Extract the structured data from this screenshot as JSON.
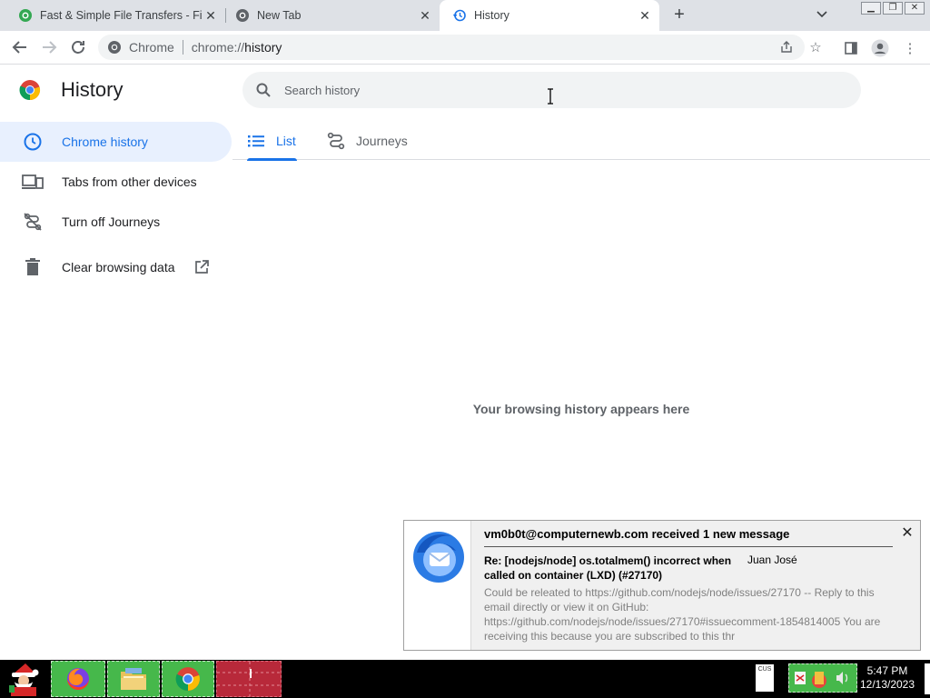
{
  "tabs": [
    {
      "title": "Fast & Simple File Transfers - File",
      "icon": "green-globe-icon"
    },
    {
      "title": "New Tab",
      "icon": "chrome-globe-icon"
    },
    {
      "title": "History",
      "icon": "history-clock-icon"
    }
  ],
  "omnibox": {
    "origin": "Chrome",
    "scheme": "chrome://",
    "path": "history"
  },
  "history": {
    "title": "History",
    "search_placeholder": "Search history",
    "sidebar": [
      {
        "label": "Chrome history",
        "icon": "clock-icon",
        "selected": true
      },
      {
        "label": "Tabs from other devices",
        "icon": "devices-icon"
      },
      {
        "label": "Turn off Journeys",
        "icon": "journeys-off-icon"
      },
      {
        "label": "Clear browsing data",
        "icon": "trash-icon"
      }
    ],
    "page_tabs": [
      {
        "label": "List",
        "icon": "list-icon",
        "active": true
      },
      {
        "label": "Journeys",
        "icon": "journeys-icon"
      }
    ],
    "empty_message": "Your browsing history appears here"
  },
  "notification": {
    "heading": "vm0b0t@computernewb.com received 1 new message",
    "subject": "Re: [nodejs/node] os.totalmem() incorrect when called on container (LXD) (#27170)",
    "sender": "Juan José",
    "body": "Could be releated to https://github.com/nodejs/node/issues/27170 -- Reply to this email directly or view it on GitHub: https://github.com/nodejs/node/issues/27170#issuecomment-1854814005 You are receiving this because you are subscribed to this thr"
  },
  "taskbar": {
    "tray_label": "CUS",
    "time": "5:47 PM",
    "date": "12/13/2023"
  },
  "colors": {
    "accent": "#1a73e8",
    "selected_bg": "#e8f0fe",
    "taskbar_green": "#46b84b",
    "taskbar_red": "#b8293a"
  }
}
